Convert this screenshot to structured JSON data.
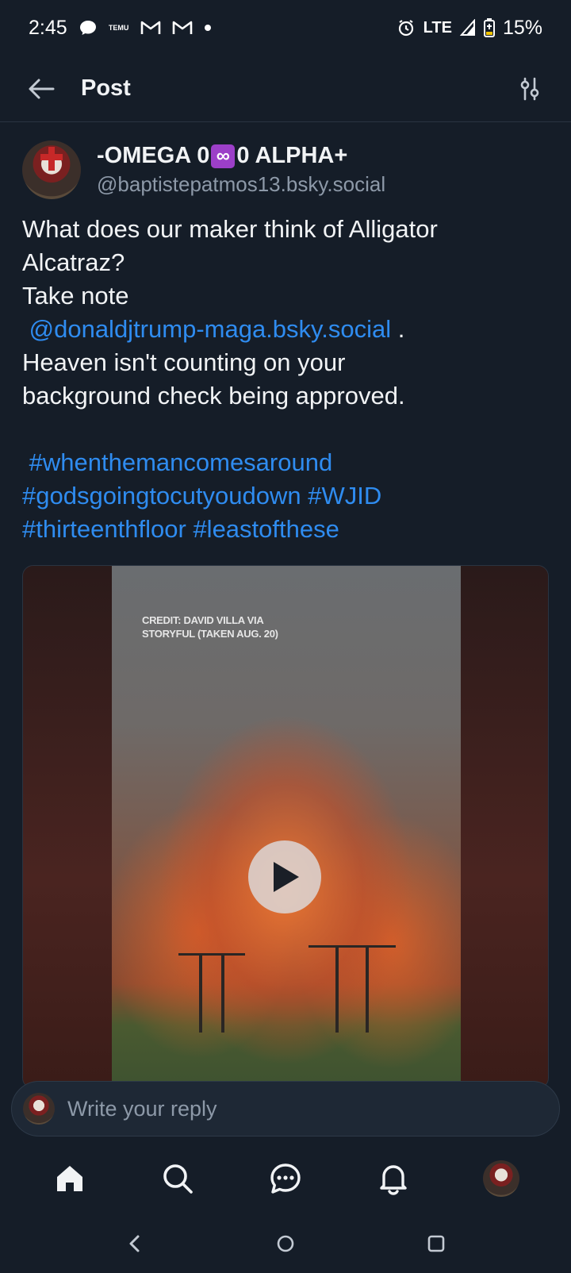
{
  "status_bar": {
    "time": "2:45",
    "temu_label_top": "ঠমূ",
    "temu_label_bottom": "TEMU",
    "network": "LTE",
    "battery": "15%"
  },
  "header": {
    "title": "Post"
  },
  "post": {
    "display_name_pre": "-OMEGA 0",
    "display_name_emoji": "∞",
    "display_name_post": "0 ALPHA+",
    "handle": "@baptistepatmos13.bsky.social",
    "line1": "What does our maker think of Alligator",
    "line2": "Alcatraz?",
    "line3": "Take note",
    "mention": "@donaldjtrump-maga.bsky.social",
    "mention_suffix": " .",
    "line5": "Heaven isn't counting on your",
    "line6": "background check being approved.",
    "hashtags": {
      "h1": "#whenthemancomesaround",
      "h2": "#godsgoingtocutyoudown",
      "h3": "#WJID",
      "h4": "#thirteenthfloor",
      "h5": "#leastofthese"
    },
    "video_credit_line1": "CREDIT: DAVID VILLA VIA",
    "video_credit_line2": "STORYFUL (TAKEN AUG. 20)"
  },
  "reply": {
    "placeholder": "Write your reply"
  },
  "colors": {
    "background": "#151d28",
    "link": "#2f8cf0",
    "muted": "#8d99a8"
  }
}
